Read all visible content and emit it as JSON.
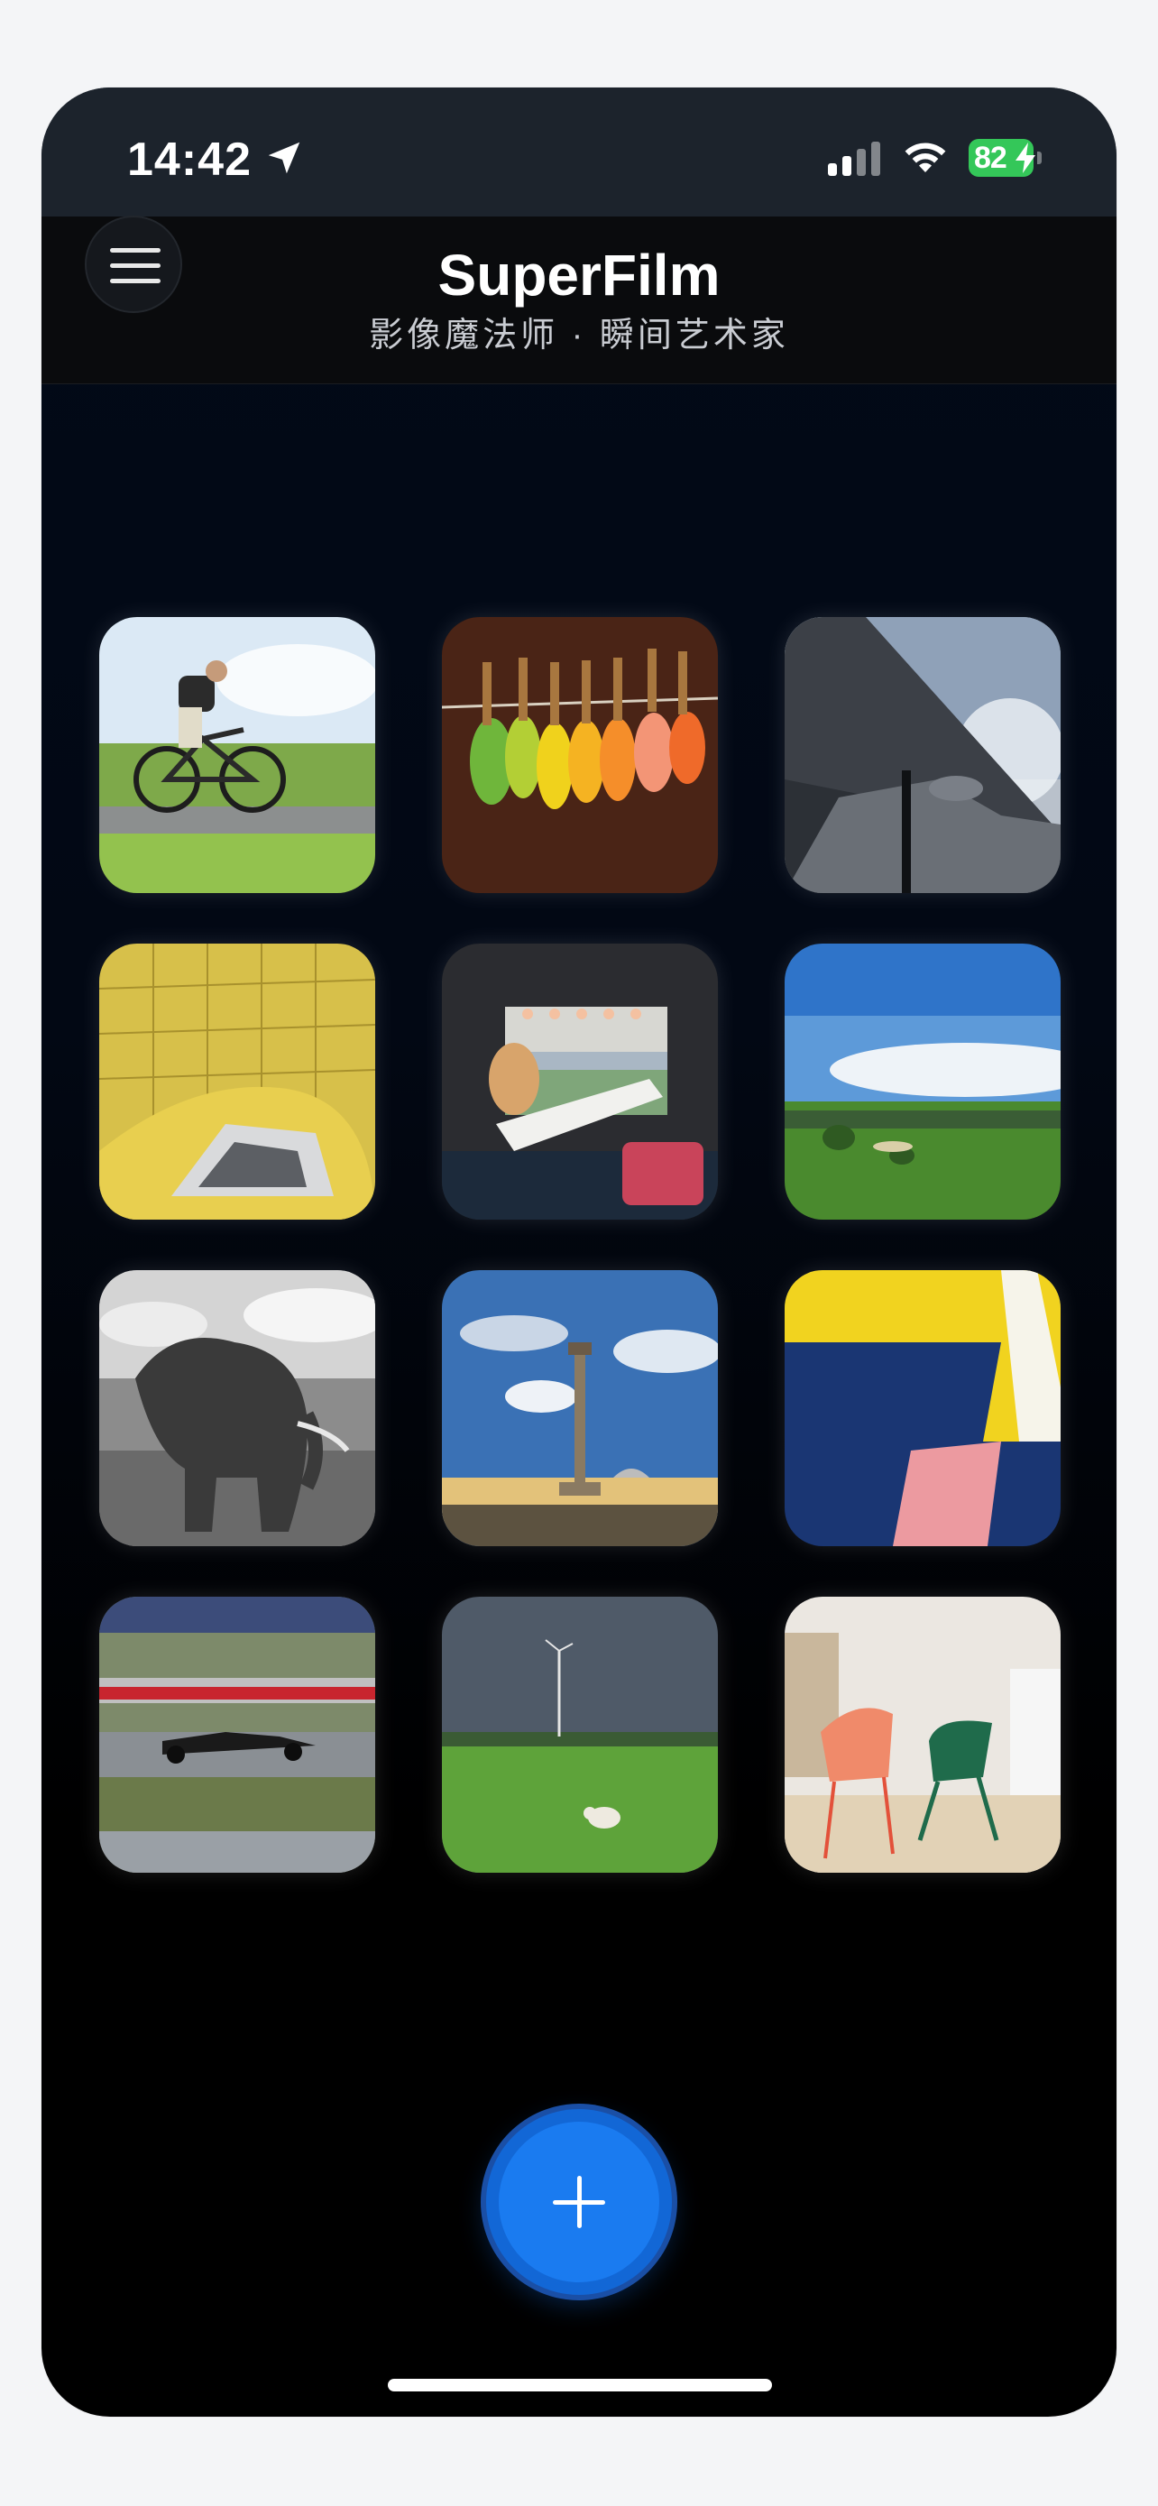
{
  "status_bar": {
    "time": "14:42",
    "battery_level": "82"
  },
  "header": {
    "title": "SuperFilm",
    "subtitle": "影像魔法师 · 瞬间艺术家"
  },
  "gallery": {
    "photos": [
      {
        "subject": "cyclist on road"
      },
      {
        "subject": "autumn leaves on clothespins"
      },
      {
        "subject": "vintage airplane wing"
      },
      {
        "subject": "yellow tiled architecture"
      },
      {
        "subject": "woman relaxing in camper van"
      },
      {
        "subject": "golf course landscape"
      },
      {
        "subject": "elephant black and white"
      },
      {
        "subject": "city square with column"
      },
      {
        "subject": "colorful painted wall"
      },
      {
        "subject": "race car on track"
      },
      {
        "subject": "cow on green field"
      },
      {
        "subject": "colorful chairs in room"
      }
    ]
  },
  "colors": {
    "accent": "#1a7bf0",
    "battery": "#34c759",
    "header_bg": "#0a0b0d",
    "status_bg": "#1c232c"
  }
}
